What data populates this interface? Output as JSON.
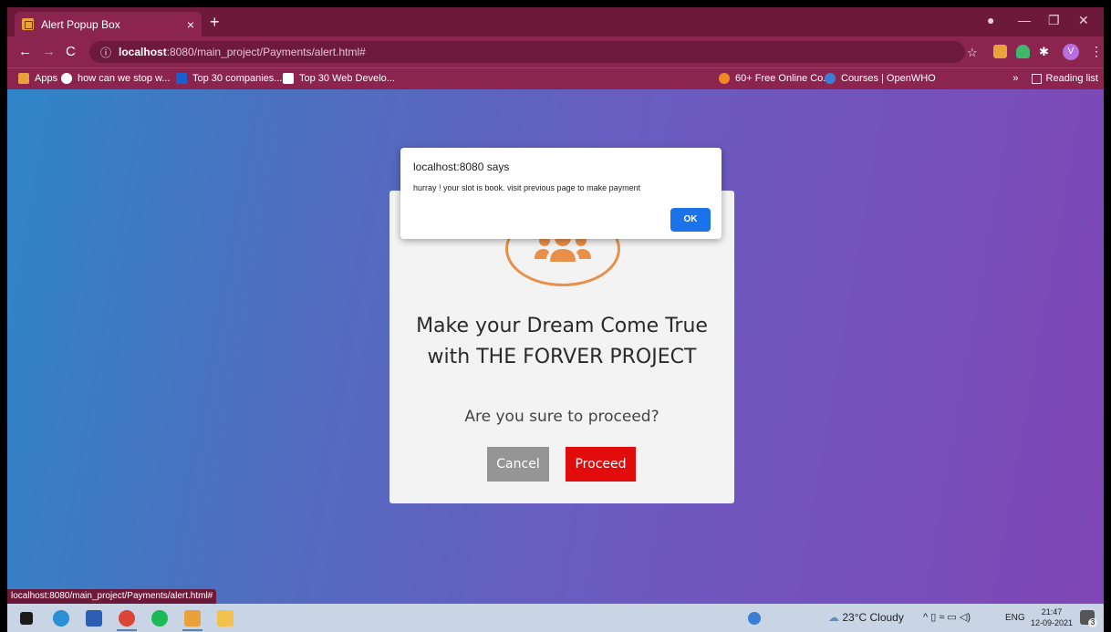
{
  "browser": {
    "tab_title": "Alert Popup Box",
    "tab_close": "×",
    "new_tab": "+",
    "window_controls": [
      "—",
      "❐",
      "✕"
    ],
    "url_host": "localhost",
    "url_rest": ":8080/main_project/Payments/alert.html#",
    "bookmarks": [
      {
        "label": "Apps",
        "icon": "apps-grid-icon",
        "color": "#e8a13b"
      },
      {
        "label": "how can we stop w...",
        "icon": "google-icon",
        "color": "#ffffff"
      },
      {
        "label": "Top 30 companies...",
        "icon": "d-icon",
        "color": "#1a5fd0"
      },
      {
        "label": "Top 30 Web Develo...",
        "icon": "site-icon",
        "color": "#ffffff"
      },
      {
        "label": "60+ Free Online Co...",
        "icon": "site-icon",
        "color": "#f08a24"
      },
      {
        "label": "Courses | OpenWHO",
        "icon": "who-icon",
        "color": "#3a7fd5"
      }
    ],
    "bookmarks_more": "»",
    "reading_list": "Reading list",
    "profile_letter": "V"
  },
  "alert": {
    "title": "localhost:8080 says",
    "message": "hurray ! your slot is book. visit previous page to make payment",
    "ok_label": "OK"
  },
  "card": {
    "heading": "Make your Dream Come True with THE FORVER PROJECT",
    "subtext": "Are you sure to proceed?",
    "cancel_label": "Cancel",
    "proceed_label": "Proceed",
    "icon": "users-group-icon",
    "accent_color": "#e8904a"
  },
  "status_url": "localhost:8080/main_project/Payments/alert.html#",
  "taskbar": {
    "weather": "23°C Cloudy",
    "language": "ENG",
    "time": "21:47",
    "date": "12-09-2021",
    "notifications": "3"
  }
}
